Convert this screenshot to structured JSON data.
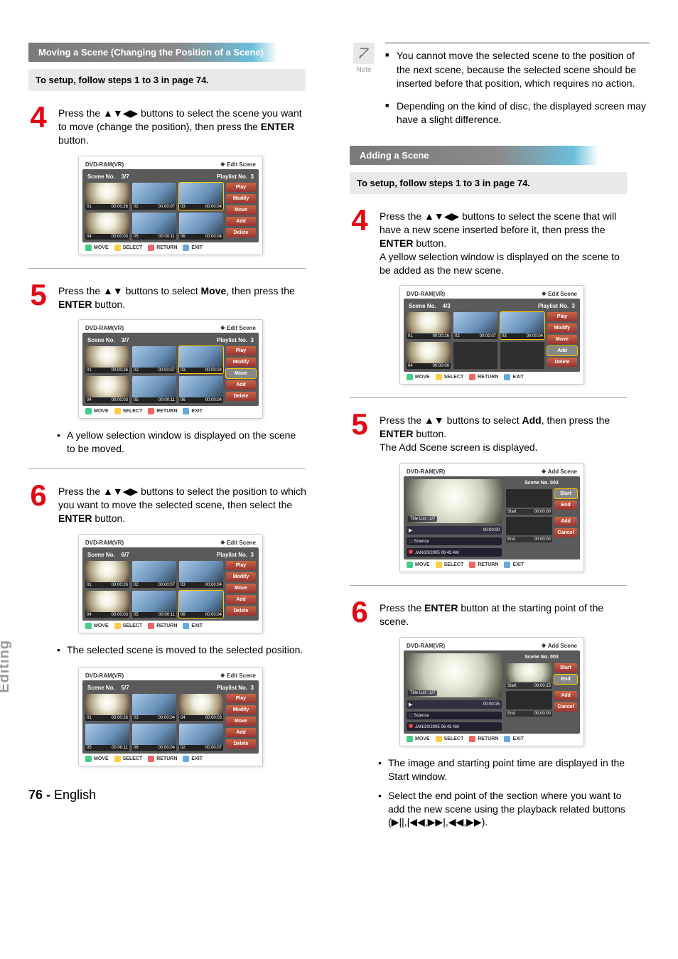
{
  "side_tab": "Editing",
  "footer_page": "76 -",
  "footer_lang": "English",
  "left": {
    "section_title": "Moving a Scene (Changing the Position of a Scene)",
    "setup": "To setup, follow steps 1 to 3 in page 74.",
    "step4": {
      "num": "4",
      "text_a": "Press the ",
      "arrows": "▲▼◀▶",
      "text_b": " buttons to select the scene you want to move (change the position), then press the ",
      "bold": "ENTER",
      "text_c": " button."
    },
    "step5": {
      "num": "5",
      "text_a": "Press the ",
      "arrows": "▲▼",
      "text_b": " buttons to select ",
      "bold1": "Move",
      "text_c": ", then press the ",
      "bold2": "ENTER",
      "text_d": " button."
    },
    "bullet5": "A yellow selection window is displayed on the scene to be moved.",
    "step6": {
      "num": "6",
      "text_a": "Press the ",
      "arrows": "▲▼◀▶",
      "text_b": " buttons to select the position to which you want to move the selected scene, then select the ",
      "bold": "ENTER",
      "text_c": " button."
    },
    "bullet6": "The selected scene is moved to the selected position."
  },
  "right": {
    "note_label": "Note",
    "note1": "You cannot move the selected scene to the position of the next scene, because the selected scene should be inserted before that position, which requires no action.",
    "note2": "Depending on the kind of disc, the displayed screen may have a slight difference.",
    "section_title": "Adding a Scene",
    "setup": "To setup, follow steps 1 to 3 in page 74.",
    "step4": {
      "num": "4",
      "text_a": "Press the ",
      "arrows": "▲▼◀▶",
      "text_b": " buttons to select the scene that will have a new scene inserted before it, then press the ",
      "bold": "ENTER",
      "text_c": " button.",
      "sub": "A yellow selection window is displayed on the scene to be added as the new scene."
    },
    "step5": {
      "num": "5",
      "text_a": "Press the ",
      "arrows": "▲▼",
      "text_b": " buttons to select ",
      "bold1": "Add",
      "text_c": ", then press the ",
      "bold2": "ENTER",
      "text_d": " button.",
      "sub": "The Add Scene screen is displayed."
    },
    "step6": {
      "num": "6",
      "text_a": "Press the ",
      "bold": "ENTER",
      "text_b": " button at the starting point of the scene."
    },
    "bullet6a": "The image and starting point time are displayed in the Start window.",
    "bullet6b_a": "Select the end point of the section where you want to add the new scene using the playback related buttons (",
    "bullet6b_glyphs": "▶||,|◀◀,▶▶|,◀◀,▶▶",
    "bullet6b_b": ")."
  },
  "osd_edit": {
    "title_l": "DVD-RAM(VR)",
    "title_r": "Edit Scene",
    "scene_no": "Scene No.",
    "playlist": "Playlist No.",
    "playlist_n": "3",
    "btn_play": "Play",
    "btn_modify": "Modify",
    "btn_move": "Move",
    "btn_add": "Add",
    "btn_delete": "Delete",
    "foot_move": "MOVE",
    "foot_select": "SELECT",
    "foot_return": "RETURN",
    "foot_exit": "EXIT"
  },
  "osd_edit_a": {
    "page": "3/7",
    "cells": [
      {
        "n": "01",
        "t": "00:00:26"
      },
      {
        "n": "02",
        "t": "00:00:07",
        "alt": true
      },
      {
        "n": "03",
        "t": "00:00:04",
        "alt": true,
        "hl": true
      },
      {
        "n": "04",
        "t": "00:00:03"
      },
      {
        "n": "05",
        "t": "00:00:11",
        "alt": true
      },
      {
        "n": "06",
        "t": "00:00:04",
        "alt": true
      }
    ]
  },
  "osd_edit_b": {
    "page": "3/7",
    "cells": [
      {
        "n": "01",
        "t": "00:00:26"
      },
      {
        "n": "02",
        "t": "00:00:07",
        "alt": true
      },
      {
        "n": "03",
        "t": "00:00:04",
        "alt": true,
        "hl": true
      },
      {
        "n": "04",
        "t": "00:00:03"
      },
      {
        "n": "05",
        "t": "00:00:11",
        "alt": true
      },
      {
        "n": "06",
        "t": "00:00:04",
        "alt": true
      }
    ],
    "hl_btn": "move"
  },
  "osd_edit_c": {
    "page": "6/7",
    "cells": [
      {
        "n": "01",
        "t": "00:00:26"
      },
      {
        "n": "02",
        "t": "00:00:07",
        "alt": true
      },
      {
        "n": "03",
        "t": "00:00:04",
        "alt": true
      },
      {
        "n": "04",
        "t": "00:00:03"
      },
      {
        "n": "05",
        "t": "00:00:11",
        "alt": true
      },
      {
        "n": "06",
        "t": "00:00:04",
        "alt": true,
        "hl": true
      }
    ]
  },
  "osd_edit_d": {
    "page": "5/7",
    "cells": [
      {
        "n": "01",
        "t": "00:00:26"
      },
      {
        "n": "03",
        "t": "00:00:04",
        "alt": true
      },
      {
        "n": "04",
        "t": "00:00:03"
      },
      {
        "n": "05",
        "t": "00:00:11",
        "alt": true
      },
      {
        "n": "06",
        "t": "00:00:04",
        "alt": true
      },
      {
        "n": "02",
        "t": "00:00:07",
        "alt": true
      }
    ]
  },
  "osd_edit_r1": {
    "page": "4/3",
    "cells": [
      {
        "n": "01",
        "t": "00:00:26"
      },
      {
        "n": "02",
        "t": "00:00:07",
        "alt": true
      },
      {
        "n": "03",
        "t": "00:00:04",
        "alt": true,
        "hl": true
      },
      {
        "n": "04",
        "t": "00:00:00"
      },
      {
        "empty": true
      },
      {
        "empty": true
      }
    ],
    "hl_btn": "add"
  },
  "osd_add_a": {
    "title_r": "Add Scene",
    "scene_no": "Scene No. 003",
    "title_list": "Title List : 1/7",
    "science": "Science",
    "date": "JAN/20/2005 06:43 AM",
    "time_main": "00:00:00",
    "start_lbl": "Start",
    "start_t": "00:00:00",
    "end_lbl": "End",
    "end_t": "00:00:00",
    "btn_start": "Start",
    "btn_end": "End",
    "btn_add": "Add",
    "btn_cancel": "Cancel",
    "hl_btn": "start",
    "start_thumb_on": false
  },
  "osd_add_b": {
    "title_r": "Add Scene",
    "scene_no": "Scene No. 003",
    "title_list": "Title List : 1/7",
    "science": "Science",
    "date": "JAN/20/2005 06:43 AM",
    "time_main": "00:00:15",
    "start_lbl": "Start",
    "start_t": "00:00:15",
    "end_lbl": "End",
    "end_t": "00:00:00",
    "btn_start": "Start",
    "btn_end": "End",
    "btn_add": "Add",
    "btn_cancel": "Cancel",
    "hl_btn": "end",
    "start_thumb_on": true
  }
}
